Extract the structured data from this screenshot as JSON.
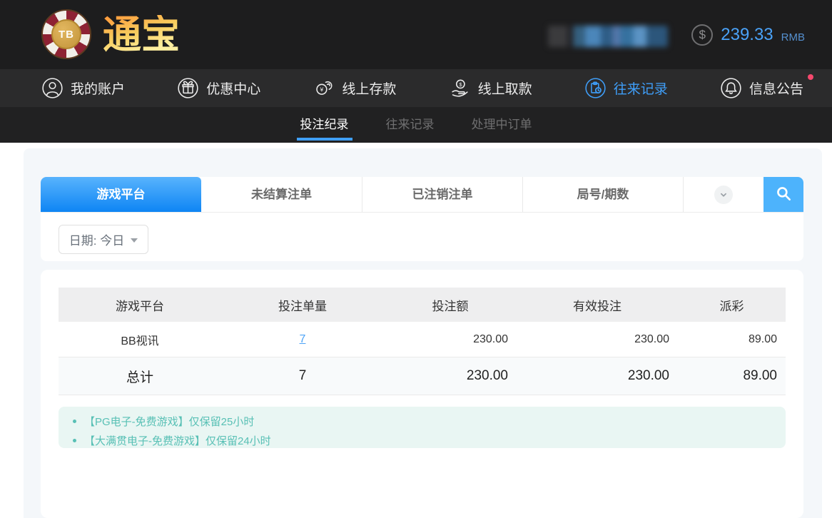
{
  "header": {
    "logo_tb": "TB",
    "logo_brand": "通宝",
    "balance_symbol": "$",
    "balance_amount": "239.33",
    "balance_currency": "RMB"
  },
  "nav": {
    "items": [
      {
        "label": "我的账户",
        "icon": "user-icon",
        "active": false
      },
      {
        "label": "优惠中心",
        "icon": "gift-icon",
        "active": false
      },
      {
        "label": "线上存款",
        "icon": "deposit-coin-icon",
        "active": false
      },
      {
        "label": "线上取款",
        "icon": "withdraw-hand-icon",
        "active": false
      },
      {
        "label": "往来记录",
        "icon": "transfer-records-icon",
        "active": true
      },
      {
        "label": "信息公告",
        "icon": "bell-icon",
        "active": false,
        "notification_dot": true
      }
    ]
  },
  "subnav": {
    "items": [
      {
        "label": "投注纪录",
        "active": true
      },
      {
        "label": "往来记录",
        "active": false
      },
      {
        "label": "处理中订单",
        "active": false
      }
    ]
  },
  "search_bar": {
    "tabs": [
      {
        "label": "游戏平台",
        "active": true
      },
      {
        "label": "未结算注单",
        "active": false
      },
      {
        "label": "已注销注单",
        "active": false
      },
      {
        "label": "局号/期数",
        "active": false
      }
    ],
    "dropdown_icon": "chevron-down-icon",
    "search_icon": "search-icon"
  },
  "filters": {
    "date_label": "日期: 今日"
  },
  "table": {
    "headers": [
      "游戏平台",
      "投注单量",
      "投注额",
      "有效投注",
      "派彩"
    ],
    "rows": [
      {
        "platform": "BB视讯",
        "bet_count": "7",
        "bet_amount": "230.00",
        "valid_bet": "230.00",
        "payout": "89.00"
      }
    ],
    "total": {
      "label": "总计",
      "bet_count": "7",
      "bet_amount": "230.00",
      "valid_bet": "230.00",
      "payout": "89.00"
    }
  },
  "notes": [
    "【PG电子-免费游戏】仅保留25小时",
    "【大满贯电子-免费游戏】仅保留24小时"
  ],
  "colors": {
    "accent_blue": "#3f9ef8",
    "tab_gradient_top": "#58b3fd",
    "tab_gradient_bottom": "#0e85f4",
    "search_button_blue": "#4db3fc",
    "balance_blue": "#4aa2f8",
    "notes_teal": "#58c0b5",
    "notes_bg": "#e9f6f3",
    "notification_red": "#f5486d",
    "header_dark": "#1d1d1e",
    "nav_dark": "#2b2b2c",
    "subnav_dark": "#212122",
    "panel_bg": "#f4f7fa",
    "table_header_bg": "#eeeeef"
  }
}
